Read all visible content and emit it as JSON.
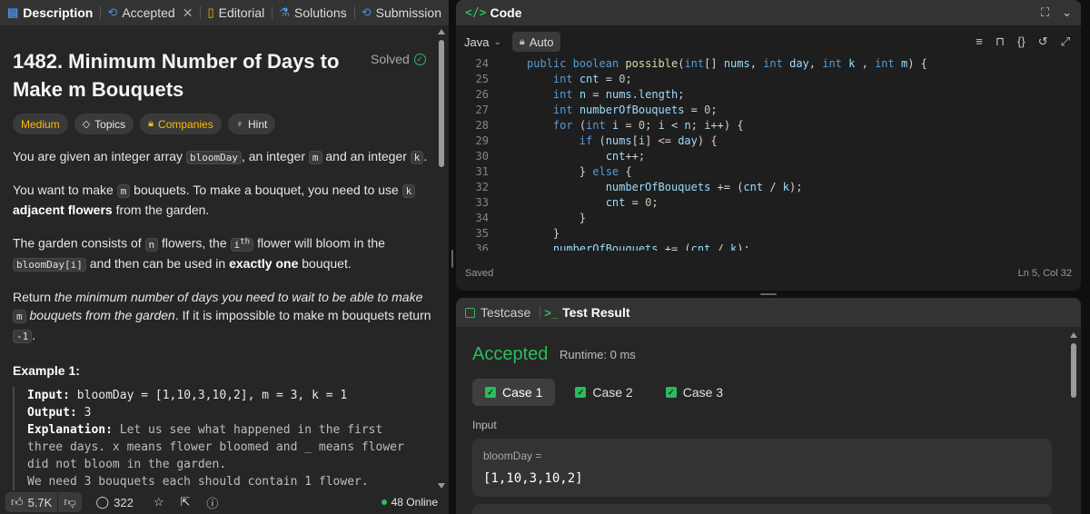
{
  "left_tabs": [
    {
      "label": "Description",
      "icon": "description-icon",
      "active": true
    },
    {
      "label": "Accepted",
      "icon": "history-icon",
      "closable": true
    },
    {
      "label": "Editorial",
      "icon": "book-icon"
    },
    {
      "label": "Solutions",
      "icon": "flask-icon"
    },
    {
      "label": "Submission",
      "icon": "history-icon"
    }
  ],
  "problem": {
    "title": "1482. Minimum Number of Days to Make m Bouquets",
    "status": "Solved",
    "tags": [
      "Medium",
      "Topics",
      "Companies",
      "Hint"
    ]
  },
  "description": {
    "p1": {
      "a": "You are given an integer array ",
      "c1": "bloomDay",
      "b": ", an integer ",
      "c2": "m",
      "c": " and an integer ",
      "c3": "k",
      "d": "."
    },
    "p2": {
      "a": "You want to make ",
      "c1": "m",
      "b": " bouquets. To make a bouquet, you need to use ",
      "c2": "k",
      "bold": "adjacent flowers",
      "c": " from the garden."
    },
    "p3": {
      "a": "The garden consists of ",
      "c1": "n",
      "b": " flowers, the ",
      "c2": "i",
      "sup": "th",
      "c": " flower will bloom in the ",
      "c3": "bloomDay[i]",
      "d": " and then can be used in ",
      "bold": "exactly one",
      "e": " bouquet."
    },
    "p4": {
      "a": "Return ",
      "ital": "the minimum number of days you need to wait to be able to make ",
      "c1": "m",
      "ital2": "bouquets from the garden",
      "b": ". If it is impossible to make m bouquets return ",
      "c2": "-1",
      "c": "."
    }
  },
  "example": {
    "title": "Example 1:",
    "input_label": "Input:",
    "input_value": "bloomDay = [1,10,3,10,2], m = 3, k = 1",
    "output_label": "Output:",
    "output_value": "3",
    "expl_label": "Explanation:",
    "expl_1": "Let us see what happened in the first",
    "expl_2": "three days. x means flower bloomed and _ means flower",
    "expl_3": "did not bloom in the garden.",
    "expl_4": "We need 3 bouquets each should contain 1 flower."
  },
  "footer": {
    "likes": "5.7K",
    "comments": "322",
    "online": "48 Online"
  },
  "code_panel": {
    "title": "Code",
    "language": "Java",
    "mode": "Auto",
    "status": "Saved",
    "cursor": "Ln 5, Col 32",
    "lines": [
      {
        "n": "24",
        "html": "<span class='kw'>public</span> <span class='kw'>boolean</span> <span class='fn'>possible</span>(<span class='kw'>int</span>[] <span class='vr'>nums</span>, <span class='kw'>int</span> <span class='vr'>day</span>, <span class='kw'>int</span> <span class='vr'>k</span> , <span class='kw'>int</span> <span class='vr'>m</span>) {"
      },
      {
        "n": "25",
        "html": "    <span class='kw'>int</span> <span class='vr'>cnt</span> = <span class='nm'>0</span>;"
      },
      {
        "n": "26",
        "html": "    <span class='kw'>int</span> <span class='vr'>n</span> = <span class='vr'>nums</span>.<span class='vr'>length</span>;"
      },
      {
        "n": "27",
        "html": "    <span class='kw'>int</span> <span class='vr'>numberOfBouquets</span> = <span class='nm'>0</span>;"
      },
      {
        "n": "28",
        "html": "    <span class='kw'>for</span> (<span class='kw'>int</span> <span class='vr'>i</span> = <span class='nm'>0</span>; <span class='vr'>i</span> &lt; <span class='vr'>n</span>; <span class='vr'>i</span>++) {"
      },
      {
        "n": "29",
        "html": "        <span class='kw'>if</span> (<span class='vr'>nums</span>[<span class='vr'>i</span>] &lt;= <span class='vr'>day</span>) {"
      },
      {
        "n": "30",
        "html": "            <span class='vr'>cnt</span>++;"
      },
      {
        "n": "31",
        "html": "        } <span class='kw'>else</span> {"
      },
      {
        "n": "32",
        "html": "            <span class='vr'>numberOfBouquets</span> += (<span class='vr'>cnt</span> / <span class='vr'>k</span>);"
      },
      {
        "n": "33",
        "html": "            <span class='vr'>cnt</span> = <span class='nm'>0</span>;"
      },
      {
        "n": "34",
        "html": "        }"
      },
      {
        "n": "35",
        "html": "    }"
      },
      {
        "n": "36",
        "html": "    <span class='vr'>numberOfBouquets</span> += (<span class='vr'>cnt</span> / <span class='vr'>k</span>);"
      }
    ]
  },
  "result_panel": {
    "tab_testcase": "Testcase",
    "tab_result": "Test Result",
    "verdict": "Accepted",
    "runtime": "Runtime: 0 ms",
    "cases": [
      "Case 1",
      "Case 2",
      "Case 3"
    ],
    "input_label": "Input",
    "var_name": "bloomDay =",
    "var_value": "[1,10,3,10,2]"
  },
  "colors": {
    "accent_green": "#2cbb5d",
    "medium_orange": "#ffb800",
    "bg": "#262626"
  }
}
